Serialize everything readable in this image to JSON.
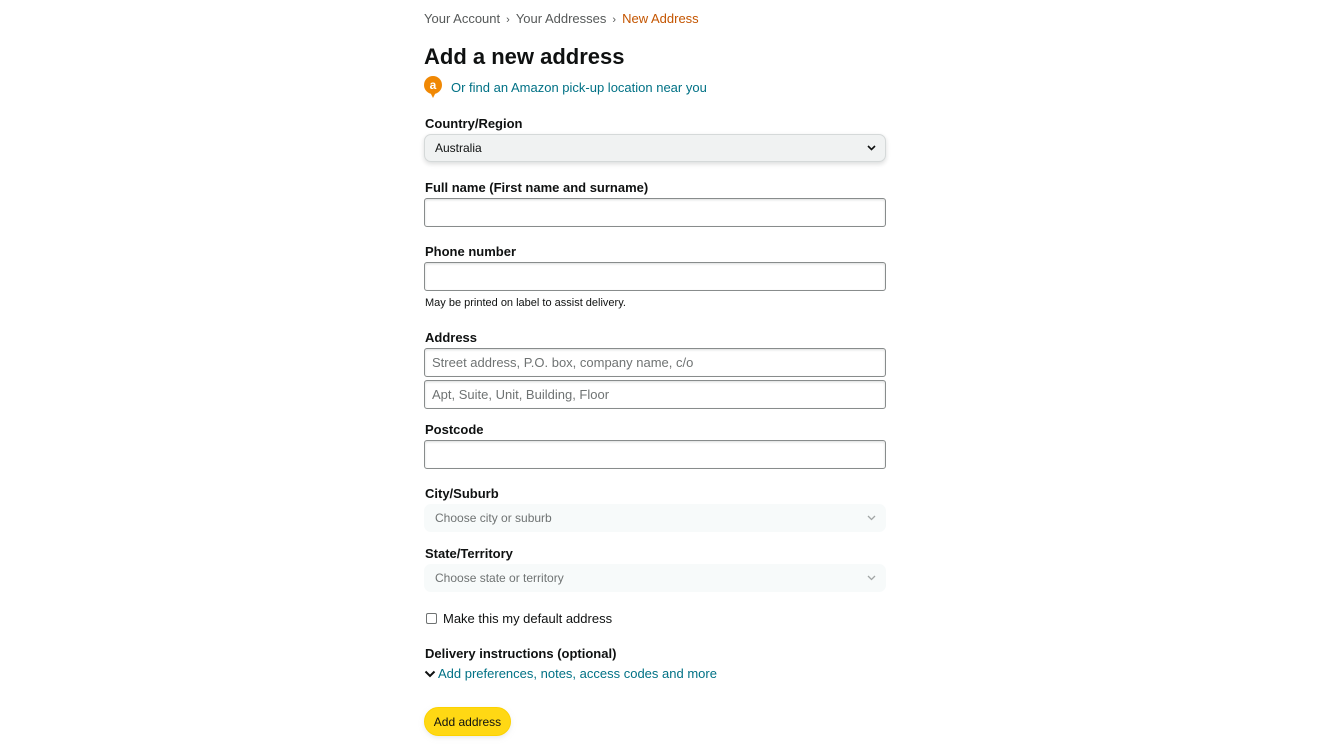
{
  "breadcrumb": {
    "items": [
      "Your Account",
      "Your Addresses"
    ],
    "separator": "›",
    "current": "New Address"
  },
  "page": {
    "title": "Add a new address",
    "pickup_icon_letter": "a",
    "pickup_link": "Or find an Amazon pick-up location near you"
  },
  "form": {
    "country": {
      "label": "Country/Region",
      "value": "Australia"
    },
    "full_name": {
      "label": "Full name (First name and surname)",
      "value": "",
      "placeholder": ""
    },
    "phone": {
      "label": "Phone number",
      "value": "",
      "placeholder": "",
      "hint": "May be printed on label to assist delivery."
    },
    "address": {
      "label": "Address",
      "line1_placeholder": "Street address, P.O. box, company name, c/o",
      "line2_placeholder": "Apt, Suite, Unit, Building, Floor"
    },
    "postcode": {
      "label": "Postcode",
      "value": "",
      "placeholder": ""
    },
    "city": {
      "label": "City/Suburb",
      "placeholder": "Choose city or suburb"
    },
    "state": {
      "label": "State/Territory",
      "placeholder": "Choose state or territory"
    },
    "default_checkbox": {
      "label": "Make this my default address",
      "checked": false
    },
    "delivery": {
      "label": "Delivery instructions (optional)",
      "link": "Add preferences, notes, access codes and more"
    },
    "submit_label": "Add address"
  },
  "colors": {
    "link": "#007185",
    "breadcrumb_current": "#c45500",
    "button": "#ffd814",
    "pin": "#f08804"
  },
  "icons": {
    "pin": "location-pin-icon",
    "chevron": "chevron-down-icon"
  }
}
